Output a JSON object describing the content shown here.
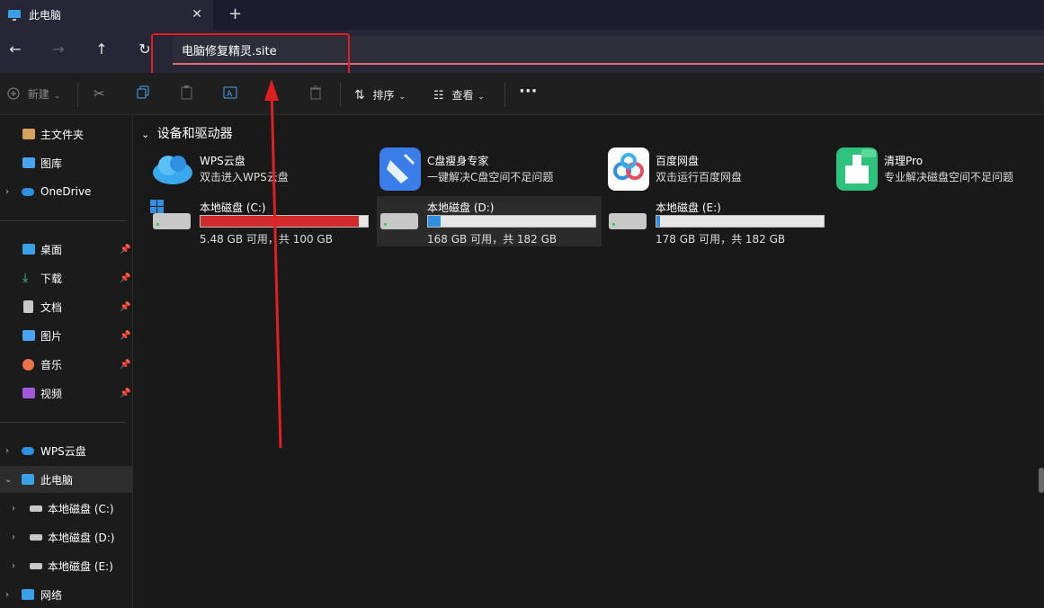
{
  "window": {
    "tab_title": "此电脑",
    "close_tab": "✕",
    "new_tab": "+"
  },
  "nav": {
    "back": "←",
    "forward": "→",
    "up": "↑",
    "refresh": "↻",
    "address": "电脑修复精灵.site"
  },
  "toolbar": {
    "new_label": "新建",
    "sort_label": "排序",
    "view_label": "查看",
    "more": "···"
  },
  "sidebar": {
    "home": "主文件夹",
    "gallery": "图库",
    "onedrive": "OneDrive",
    "desktop": "桌面",
    "downloads": "下载",
    "documents": "文档",
    "pictures": "图片",
    "music": "音乐",
    "videos": "视频",
    "wps": "WPS云盘",
    "this_pc": "此电脑",
    "drive_c": "本地磁盘 (C:)",
    "drive_d": "本地磁盘 (D:)",
    "drive_e": "本地磁盘 (E:)",
    "network": "网络"
  },
  "main": {
    "section_title": "设备和驱动器",
    "apps": [
      {
        "name": "WPS云盘",
        "desc": "双击进入WPS云盘"
      },
      {
        "name": "C盘瘦身专家",
        "desc": "一键解决C盘空间不足问题"
      },
      {
        "name": "百度网盘",
        "desc": "双击运行百度网盘"
      },
      {
        "name": "清理Pro",
        "desc": "专业解决磁盘空间不足问题"
      }
    ],
    "drives": [
      {
        "name": "本地磁盘 (C:)",
        "free": "5.48 GB 可用，共 100 GB",
        "used_fraction": 0.945,
        "bar_color": "#d02a2a"
      },
      {
        "name": "本地磁盘 (D:)",
        "free": "168 GB 可用，共 182 GB",
        "used_fraction": 0.077,
        "bar_color": "#2f8fe0"
      },
      {
        "name": "本地磁盘 (E:)",
        "free": "178 GB 可用，共 182 GB",
        "used_fraction": 0.022,
        "bar_color": "#2f8fe0"
      }
    ]
  }
}
